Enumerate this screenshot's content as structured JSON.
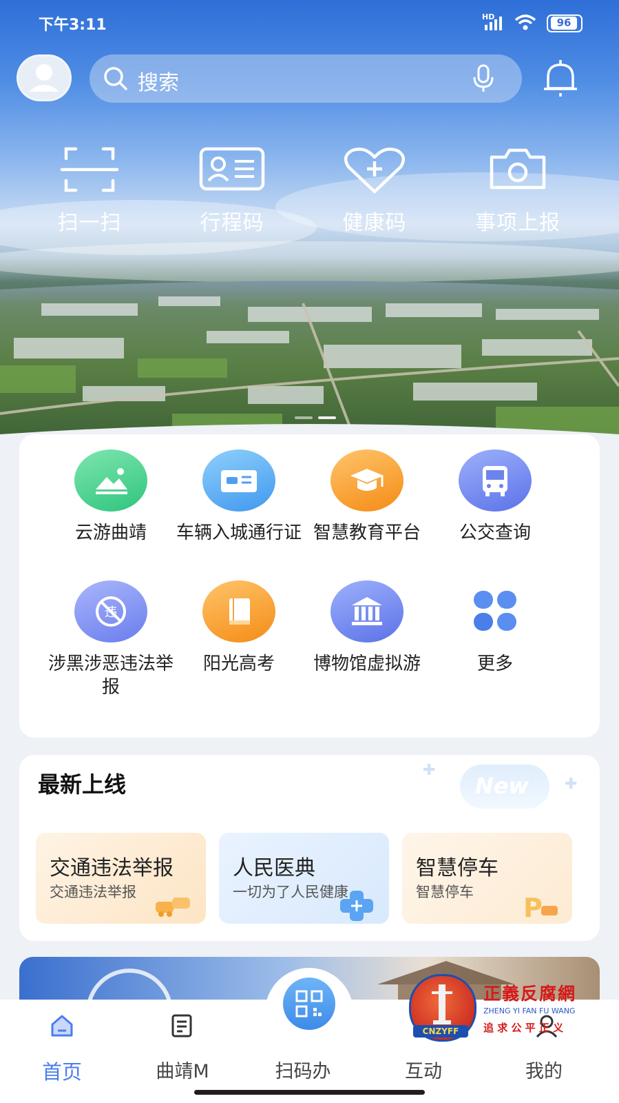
{
  "status_bar": {
    "time": "下午3:11",
    "battery": "96",
    "network": "HD"
  },
  "search": {
    "placeholder": "搜索"
  },
  "quick_actions": [
    {
      "label": "扫一扫",
      "icon": "scan-icon"
    },
    {
      "label": "行程码",
      "icon": "id-card-icon"
    },
    {
      "label": "健康码",
      "icon": "heart-plus-icon"
    },
    {
      "label": "事项上报",
      "icon": "camera-icon"
    }
  ],
  "services": [
    {
      "label": "云游曲靖",
      "icon": "landscape-icon",
      "color": "#3fcf8e"
    },
    {
      "label": "车辆入城通行证",
      "icon": "vehicle-pass-icon",
      "color": "#5aa8f2"
    },
    {
      "label": "智慧教育平台",
      "icon": "graduation-cap-icon",
      "color": "#f7a133"
    },
    {
      "label": "公交查询",
      "icon": "bus-icon",
      "color": "#6f86ee"
    },
    {
      "label": "涉黑涉恶违法举报",
      "icon": "no-violation-icon",
      "color": "#7f8df0"
    },
    {
      "label": "阳光高考",
      "icon": "book-icon",
      "color": "#f8a43a"
    },
    {
      "label": "博物馆虚拟游",
      "icon": "museum-icon",
      "color": "#6c86ee"
    },
    {
      "label": "更多",
      "icon": "more-grid-icon",
      "color": "#4a86ef"
    }
  ],
  "latest": {
    "title": "最新上线",
    "badge": "New",
    "items": [
      {
        "title": "交通违法举报",
        "subtitle": "交通违法举报",
        "icon": "car-crash-icon"
      },
      {
        "title": "人民医典",
        "subtitle": "一切为了人民健康",
        "icon": "medical-cross-icon"
      },
      {
        "title": "智慧停车",
        "subtitle": "智慧停车",
        "icon": "parking-icon"
      }
    ]
  },
  "nav": {
    "items": [
      {
        "label": "首页",
        "icon": "home-icon",
        "active": true
      },
      {
        "label": "曲靖M",
        "icon": "document-icon",
        "active": false
      },
      {
        "label": "扫码办",
        "icon": "qr-code-icon",
        "active": false
      },
      {
        "label": "互动",
        "icon": "chat-icon",
        "active": false
      },
      {
        "label": "我的",
        "icon": "user-icon",
        "active": false
      }
    ]
  },
  "watermark": {
    "title": "正義反腐網",
    "pinyin": "ZHENG YI FAN FU WANG",
    "slogan": "追 求 公 平 正 义",
    "badge": "CNZYFF"
  },
  "colors": {
    "accent": "#4a7df0",
    "nav_active": "#4a7df0"
  }
}
